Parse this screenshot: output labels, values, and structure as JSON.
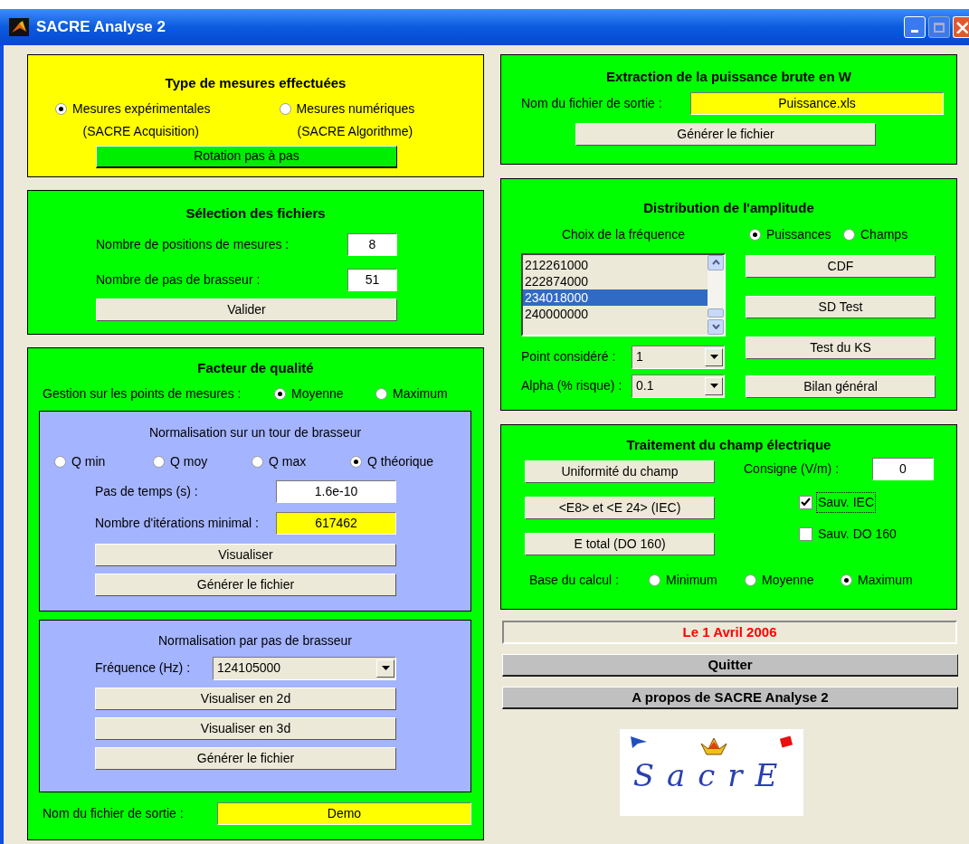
{
  "window": {
    "title": "SACRE Analyse 2"
  },
  "type_mesures": {
    "title": "Type de mesures effectuées",
    "options": [
      {
        "label": "Mesures expérimentales",
        "sublabel": "(SACRE Acquisition)",
        "selected": true
      },
      {
        "label": "Mesures numériques",
        "sublabel": "(SACRE Algorithme)",
        "selected": false
      }
    ],
    "button": "Rotation pas à pas"
  },
  "selection_fichiers": {
    "title": "Sélection des fichiers",
    "fields": [
      {
        "label": "Nombre de positions de mesures :",
        "value": "8"
      },
      {
        "label": "Nombre de pas de brasseur :",
        "value": "51"
      }
    ],
    "button": "Valider"
  },
  "facteur_qualite": {
    "title": "Facteur de qualité",
    "gestion": {
      "label": "Gestion sur les points de mesures :",
      "options": [
        {
          "label": "Moyenne",
          "selected": true
        },
        {
          "label": "Maximum",
          "selected": false
        }
      ]
    },
    "tour": {
      "title": "Normalisation sur un tour de brasseur",
      "options": [
        {
          "label": "Q min",
          "selected": false
        },
        {
          "label": "Q moy",
          "selected": false
        },
        {
          "label": "Q max",
          "selected": false
        },
        {
          "label": "Q théorique",
          "selected": true
        }
      ],
      "fields": [
        {
          "label": "Pas de temps (s) :",
          "value": "1.6e-10",
          "highlighted": false
        },
        {
          "label": "Nombre d'itérations minimal :",
          "value": "617462",
          "highlighted": true
        }
      ],
      "buttons": [
        "Visualiser",
        "Générer le fichier"
      ]
    },
    "pas": {
      "title": "Normalisation par pas de brasseur",
      "frequency": {
        "label": "Fréquence (Hz) :",
        "value": "124105000"
      },
      "buttons": [
        "Visualiser en 2d",
        "Visualiser en 3d",
        "Générer le fichier"
      ]
    },
    "output": {
      "label": "Nom du fichier de sortie :",
      "value": "Demo"
    }
  },
  "extraction": {
    "title": "Extraction de la puissance brute en W",
    "output": {
      "label": "Nom du fichier de sortie :",
      "value": "Puissance.xls"
    },
    "button": "Générer le fichier"
  },
  "distribution": {
    "title": "Distribution de l'amplitude",
    "list_label": "Choix de la fréquence",
    "options": [
      {
        "label": "Puissances",
        "selected": true
      },
      {
        "label": "Champs",
        "selected": false
      }
    ],
    "frequencies": [
      {
        "value": "212261000",
        "selected": false
      },
      {
        "value": "222874000",
        "selected": false
      },
      {
        "value": "234018000",
        "selected": true
      },
      {
        "value": "240000000",
        "selected": false
      }
    ],
    "selects": [
      {
        "label": "Point considéré :",
        "value": "1"
      },
      {
        "label": "Alpha (% risque) :",
        "value": "0.1"
      }
    ],
    "buttons": [
      "CDF",
      "SD Test",
      "Test du KS",
      "Bilan général"
    ]
  },
  "traitement": {
    "title": "Traitement du champ électrique",
    "buttons": [
      "Uniformité du champ",
      "<E8> et <E 24> (IEC)",
      "E total (DO 160)"
    ],
    "consigne": {
      "label": "Consigne (V/m) :",
      "value": "0"
    },
    "checkboxes": [
      {
        "label": "Sauv. IEC",
        "checked": true,
        "focused": true
      },
      {
        "label": "Sauv. DO 160",
        "checked": false,
        "focused": false
      }
    ],
    "base": {
      "label": "Base du calcul :",
      "options": [
        {
          "label": "Minimum",
          "selected": false
        },
        {
          "label": "Moyenne",
          "selected": false
        },
        {
          "label": "Maximum",
          "selected": true
        }
      ]
    }
  },
  "date": "Le 1 Avril 2006",
  "actions": [
    "Quitter",
    "A propos de SACRE Analyse 2"
  ],
  "logo": {
    "text": "SacrE"
  }
}
